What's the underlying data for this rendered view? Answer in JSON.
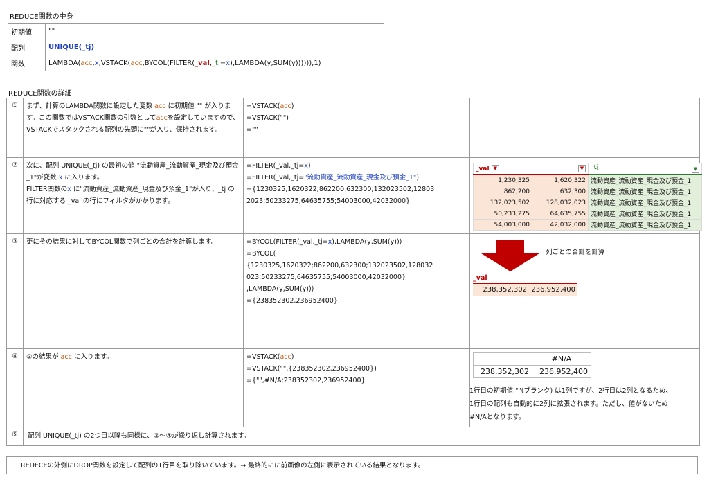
{
  "top": {
    "title": "REDUCE関数の中身",
    "rows": [
      {
        "label": "初期値",
        "value": "\"\""
      },
      {
        "label": "配列",
        "value": "UNIQUE(_tj)"
      },
      {
        "label": "関数",
        "value_parts": [
          "LAMBDA(",
          "acc",
          ",",
          "x",
          ",VSTACK(",
          "acc",
          ",BYCOL(FILTER(",
          "_val",
          ",",
          "_tj",
          "=",
          "x",
          "),LAMBDA(y,SUM(y)))))),1)"
        ]
      }
    ]
  },
  "detail": {
    "title": "REDUCE関数の詳細",
    "steps": [
      {
        "num": "①",
        "desc": [
          "まず、計算のLAMBDA関数に設定した変数 ",
          "acc",
          " に初期値 \"\" が入ります。この関数ではVSTACK関数の引数として",
          "acc",
          "を設定していますので、VSTACKでスタックされる配列の先頭に\"\"が入り、保持されます。"
        ],
        "formula": [
          "=VSTACK(acc)",
          "=VSTACK(\"\")",
          "=\"\""
        ]
      },
      {
        "num": "②",
        "desc": [
          "次に、配列 UNIQUE(_tj) の最初の値 \"流動資産_流動資産_現金及び預金_1\"が変数 ",
          "x",
          " に入ります。",
          "FILTER関数の",
          "x",
          " に\"流動資産_流動資産_現金及び預金_1\"が入り、_tj の行に対応する _val の行にフィルタがかかります。"
        ],
        "formula": [
          "=FILTER(_val,_tj=x)",
          "=FILTER(_val,_tj=\"流動資産_流動資産_現金及び預金_1\")",
          "={1230325,1620322;862200,632300;132023502,12803",
          "2023;50233275,64635755;54003000,42032000}"
        ]
      },
      {
        "num": "③",
        "desc": [
          "更にその結果に対してBYCOL関数で列ごとの合計を計算します。"
        ],
        "formula": [
          "=BYCOL(FILTER(_val,_tj=x),LAMBDA(y,SUM(y)))",
          "=BYCOL(",
          "{1230325,1620322;862200,632300;132023502,128032",
          "023;50233275,64635755;54003000,42032000}",
          ",LAMBDA(y,SUM(y)))",
          "={238352302,236952400}"
        ]
      },
      {
        "num": "④",
        "desc": [
          "③の結果が ",
          "acc",
          " に入ります。"
        ],
        "formula": [
          "=VSTACK(acc)",
          "=VSTACK(\"\",{238352302,236952400})",
          "={\"\",#N/A;238352302,236952400}"
        ]
      },
      {
        "num": "⑤",
        "desc": [
          "配列  UNIQUE(_tj) の2つ目以降も同様に、②～④が繰り返し計算されます。"
        ]
      }
    ]
  },
  "excel": {
    "headers": [
      "_val",
      "_tj"
    ],
    "rows": [
      [
        "1,230,325",
        "1,620,322",
        "流動資産_流動資産_現金及び預金_1"
      ],
      [
        "862,200",
        "632,300",
        "流動資産_流動資産_現金及び預金_1"
      ],
      [
        "132,023,502",
        "128,032,023",
        "流動資産_流動資産_現金及び預金_1"
      ],
      [
        "50,233,275",
        "64,635,755",
        "流動資産_流動資産_現金及び預金_1"
      ],
      [
        "54,003,000",
        "42,032,000",
        "流動資産_流動資産_現金及び預金_1"
      ]
    ]
  },
  "step3_panel": {
    "arrow_label": "列ごとの合計を計算",
    "val_header": "_val",
    "values": [
      "238,352,302",
      "236,952,400"
    ]
  },
  "step4_panel": {
    "grid": [
      [
        "",
        "#N/A"
      ],
      [
        "238,352,302",
        "236,952,400"
      ]
    ],
    "note": [
      "1行目の初期値 \"\"(ブランク) は1列ですが、2行目は2列となるため、",
      "1行目の配列も自動的に2列に拡張されます。ただし、値がないため",
      "#N/Aとなります。"
    ]
  },
  "footer": "REDECEの外側にDROP関数を設定して配列の1行目を取り除いています。→  最終的にに前画像の左側に表示されている結果となります。",
  "colors": {
    "orange": "#c55a11",
    "blue": "#1f3fbf",
    "red": "#c00000",
    "pink": "#fbe5d6",
    "green": "#e2efda"
  }
}
